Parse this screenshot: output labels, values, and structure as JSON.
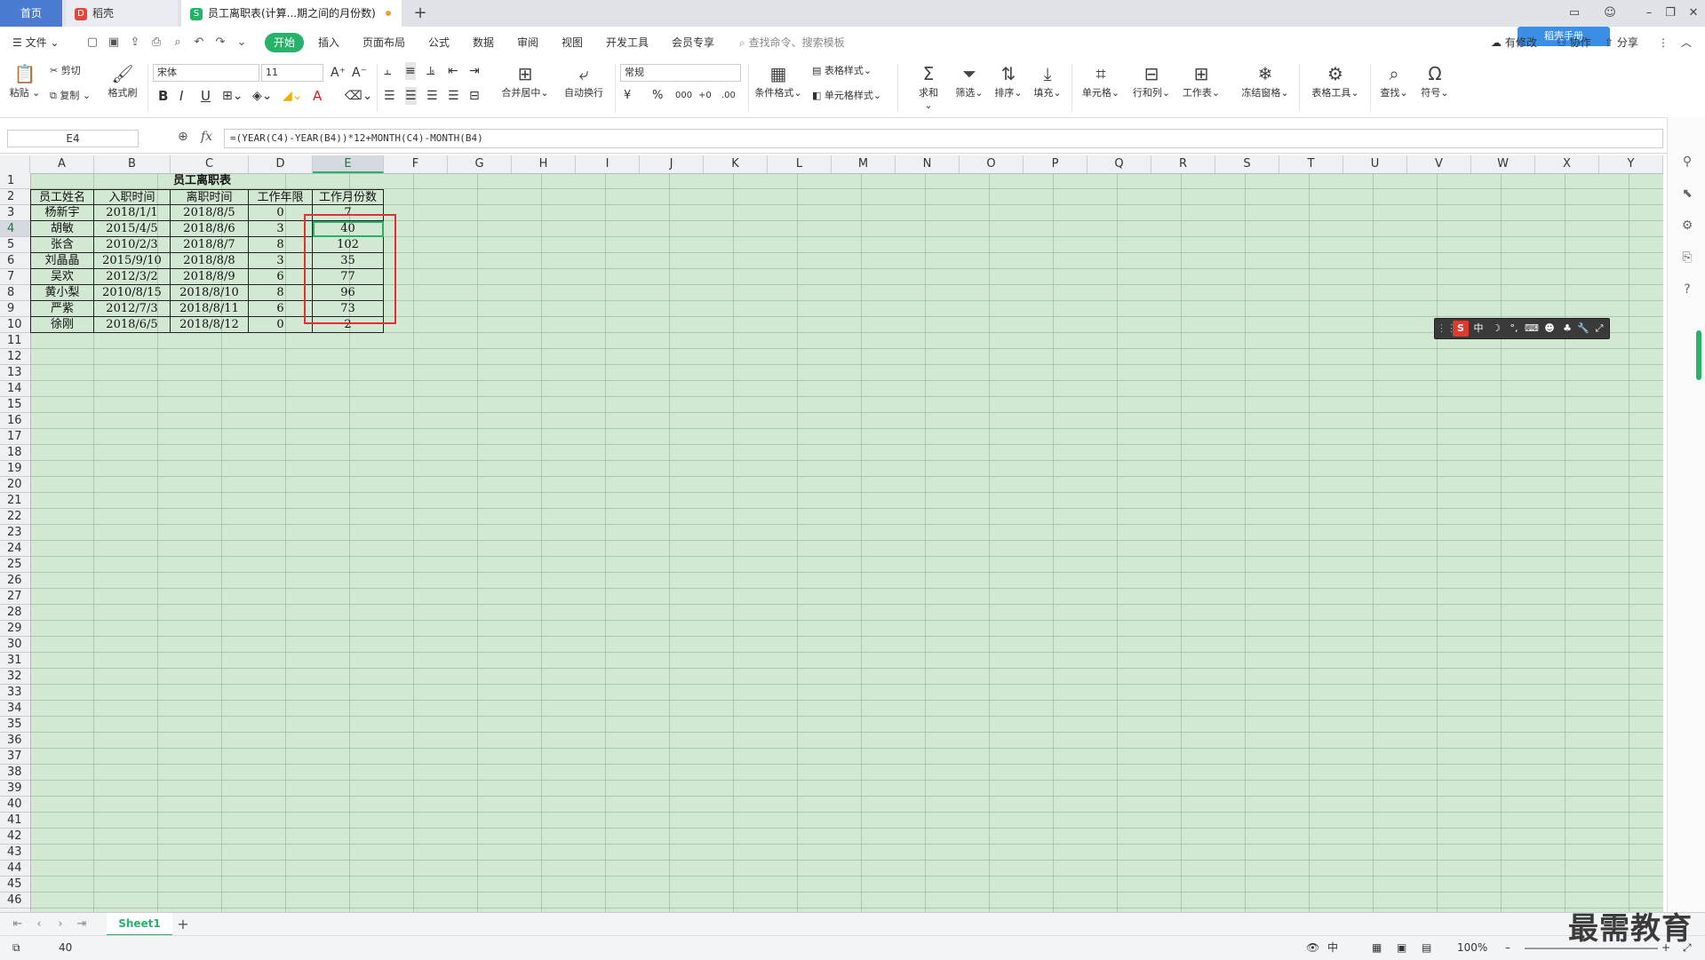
{
  "tabs": {
    "home": "首页",
    "doc": "稻壳",
    "active": "员工离职表(计算...期之间的月份数)",
    "add": "+"
  },
  "menu": {
    "file": "文件",
    "items": [
      "开始",
      "插入",
      "页面布局",
      "公式",
      "数据",
      "审阅",
      "视图",
      "开发工具",
      "会员专享"
    ],
    "search_placeholder": "查找命令、搜索模板",
    "cloud": "有修改",
    "collab": "协作",
    "share": "分享",
    "badge": "稻壳手册"
  },
  "ribbon": {
    "paste": "粘贴",
    "cut": "剪切",
    "copy": "复制",
    "format_painter": "格式刷",
    "font_name": "宋体",
    "font_size": "11",
    "merge_center": "合并居中",
    "wrap_text": "自动换行",
    "number_format": "常规",
    "currency": "¥",
    "percent": "%",
    "thousands": "000",
    "dec_inc": "+0",
    "dec_dec": ".00",
    "cond_format": "条件格式",
    "table_style": "表格样式",
    "cell_style": "单元格样式",
    "sum": "求和",
    "filter": "筛选",
    "sort": "排序",
    "fill": "填充",
    "cell": "单元格",
    "rowcol": "行和列",
    "worksheet": "工作表",
    "freeze": "冻结窗格",
    "table_tools": "表格工具",
    "find": "查找",
    "symbol": "符号",
    "bold": "B",
    "italic": "I",
    "underline": "U",
    "font_color": "A"
  },
  "formula_bar": {
    "name_box": "E4",
    "fx": "fx",
    "formula": "=(YEAR(C4)-YEAR(B4))*12+MONTH(C4)-MONTH(B4)"
  },
  "columns": [
    "A",
    "B",
    "C",
    "D",
    "E",
    "F",
    "G",
    "H",
    "I",
    "J",
    "K",
    "L",
    "M",
    "N",
    "O",
    "P",
    "Q",
    "R",
    "S",
    "T",
    "U",
    "V",
    "W",
    "X",
    "Y"
  ],
  "rows": [
    "1",
    "2",
    "3",
    "4",
    "5",
    "6",
    "7",
    "8",
    "9",
    "10",
    "11",
    "12",
    "13",
    "14",
    "15",
    "16",
    "17",
    "18",
    "19",
    "20",
    "21",
    "22",
    "23",
    "24",
    "25",
    "26",
    "27",
    "28",
    "29",
    "30",
    "31",
    "32",
    "33",
    "34",
    "35",
    "36",
    "37",
    "38",
    "39",
    "40",
    "41",
    "42",
    "43",
    "44",
    "45",
    "46"
  ],
  "sheet": {
    "title": "员工离职表",
    "headers": [
      "员工姓名",
      "入职时间",
      "离职时间",
      "工作年限",
      "工作月份数"
    ],
    "data": [
      [
        "杨新宇",
        "2018/1/1",
        "2018/8/5",
        "0",
        "7"
      ],
      [
        "胡敏",
        "2015/4/5",
        "2018/8/6",
        "3",
        "40"
      ],
      [
        "张含",
        "2010/2/3",
        "2018/8/7",
        "8",
        "102"
      ],
      [
        "刘晶晶",
        "2015/9/10",
        "2018/8/8",
        "3",
        "35"
      ],
      [
        "吴欢",
        "2012/3/2",
        "2018/8/9",
        "6",
        "77"
      ],
      [
        "黄小梨",
        "2010/8/15",
        "2018/8/10",
        "8",
        "96"
      ],
      [
        "严紫",
        "2012/7/3",
        "2018/8/11",
        "6",
        "73"
      ],
      [
        "徐刚",
        "2018/6/5",
        "2018/8/12",
        "0",
        "2"
      ]
    ]
  },
  "ime": {
    "logo": "S",
    "mode": "中",
    "moon": "☽",
    "punct": "°,"
  },
  "sheet_tabs": {
    "sheet1": "Sheet1",
    "add": "+"
  },
  "status": {
    "value": "40",
    "zoom": "100%",
    "input": "中"
  },
  "watermark": "最需教育",
  "colors": {
    "accent": "#27b26a",
    "grid_bg": "#d2e8d2",
    "highlight_box": "#e03030",
    "home_tab": "#4a7bd0"
  }
}
